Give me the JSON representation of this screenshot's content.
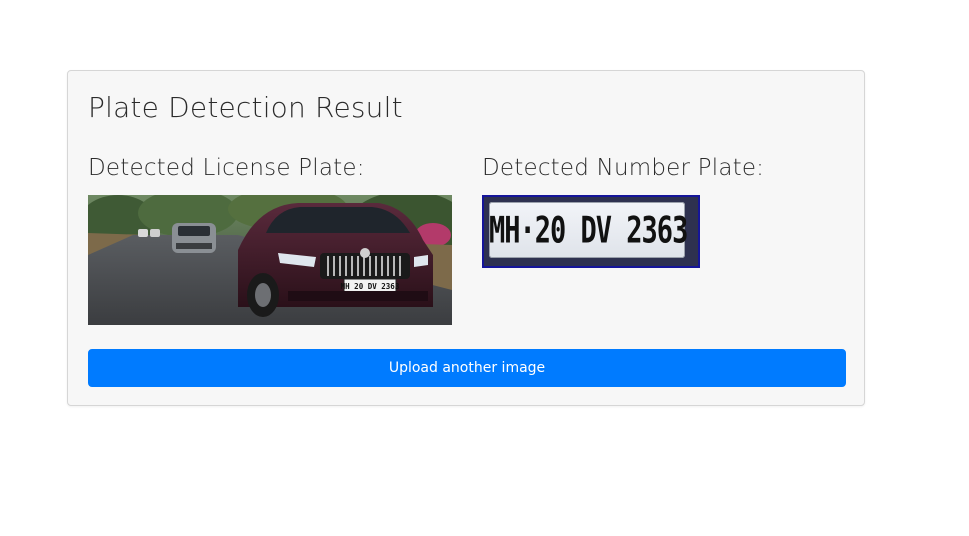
{
  "card": {
    "title": "Plate Detection Result"
  },
  "left_column": {
    "heading": "Detected License Plate:",
    "image": {
      "description_icon": "car-photo",
      "plate_text": "MH 20 DV 2363"
    }
  },
  "right_column": {
    "heading": "Detected Number Plate:",
    "image": {
      "description_icon": "plate-crop-photo",
      "plate_text": "MH·20 DV 2363"
    }
  },
  "actions": {
    "upload_label": "Upload another image"
  },
  "colors": {
    "primary": "#007bff",
    "card_bg": "#f7f7f7",
    "plate_border": "#15159a"
  }
}
